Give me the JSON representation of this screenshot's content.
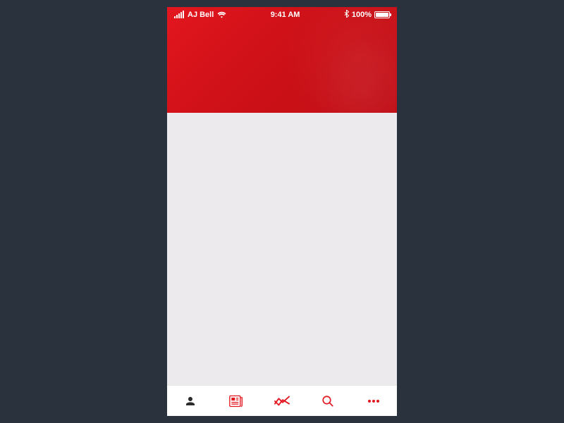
{
  "status": {
    "carrier": "AJ Bell",
    "time": "9:41 AM",
    "battery_label": "100%"
  },
  "colors": {
    "accent": "#e3161e",
    "inactive": "#2b2b2b"
  },
  "tabs": {
    "profile": "profile",
    "news": "news",
    "markets": "markets",
    "search": "search",
    "more": "more"
  }
}
